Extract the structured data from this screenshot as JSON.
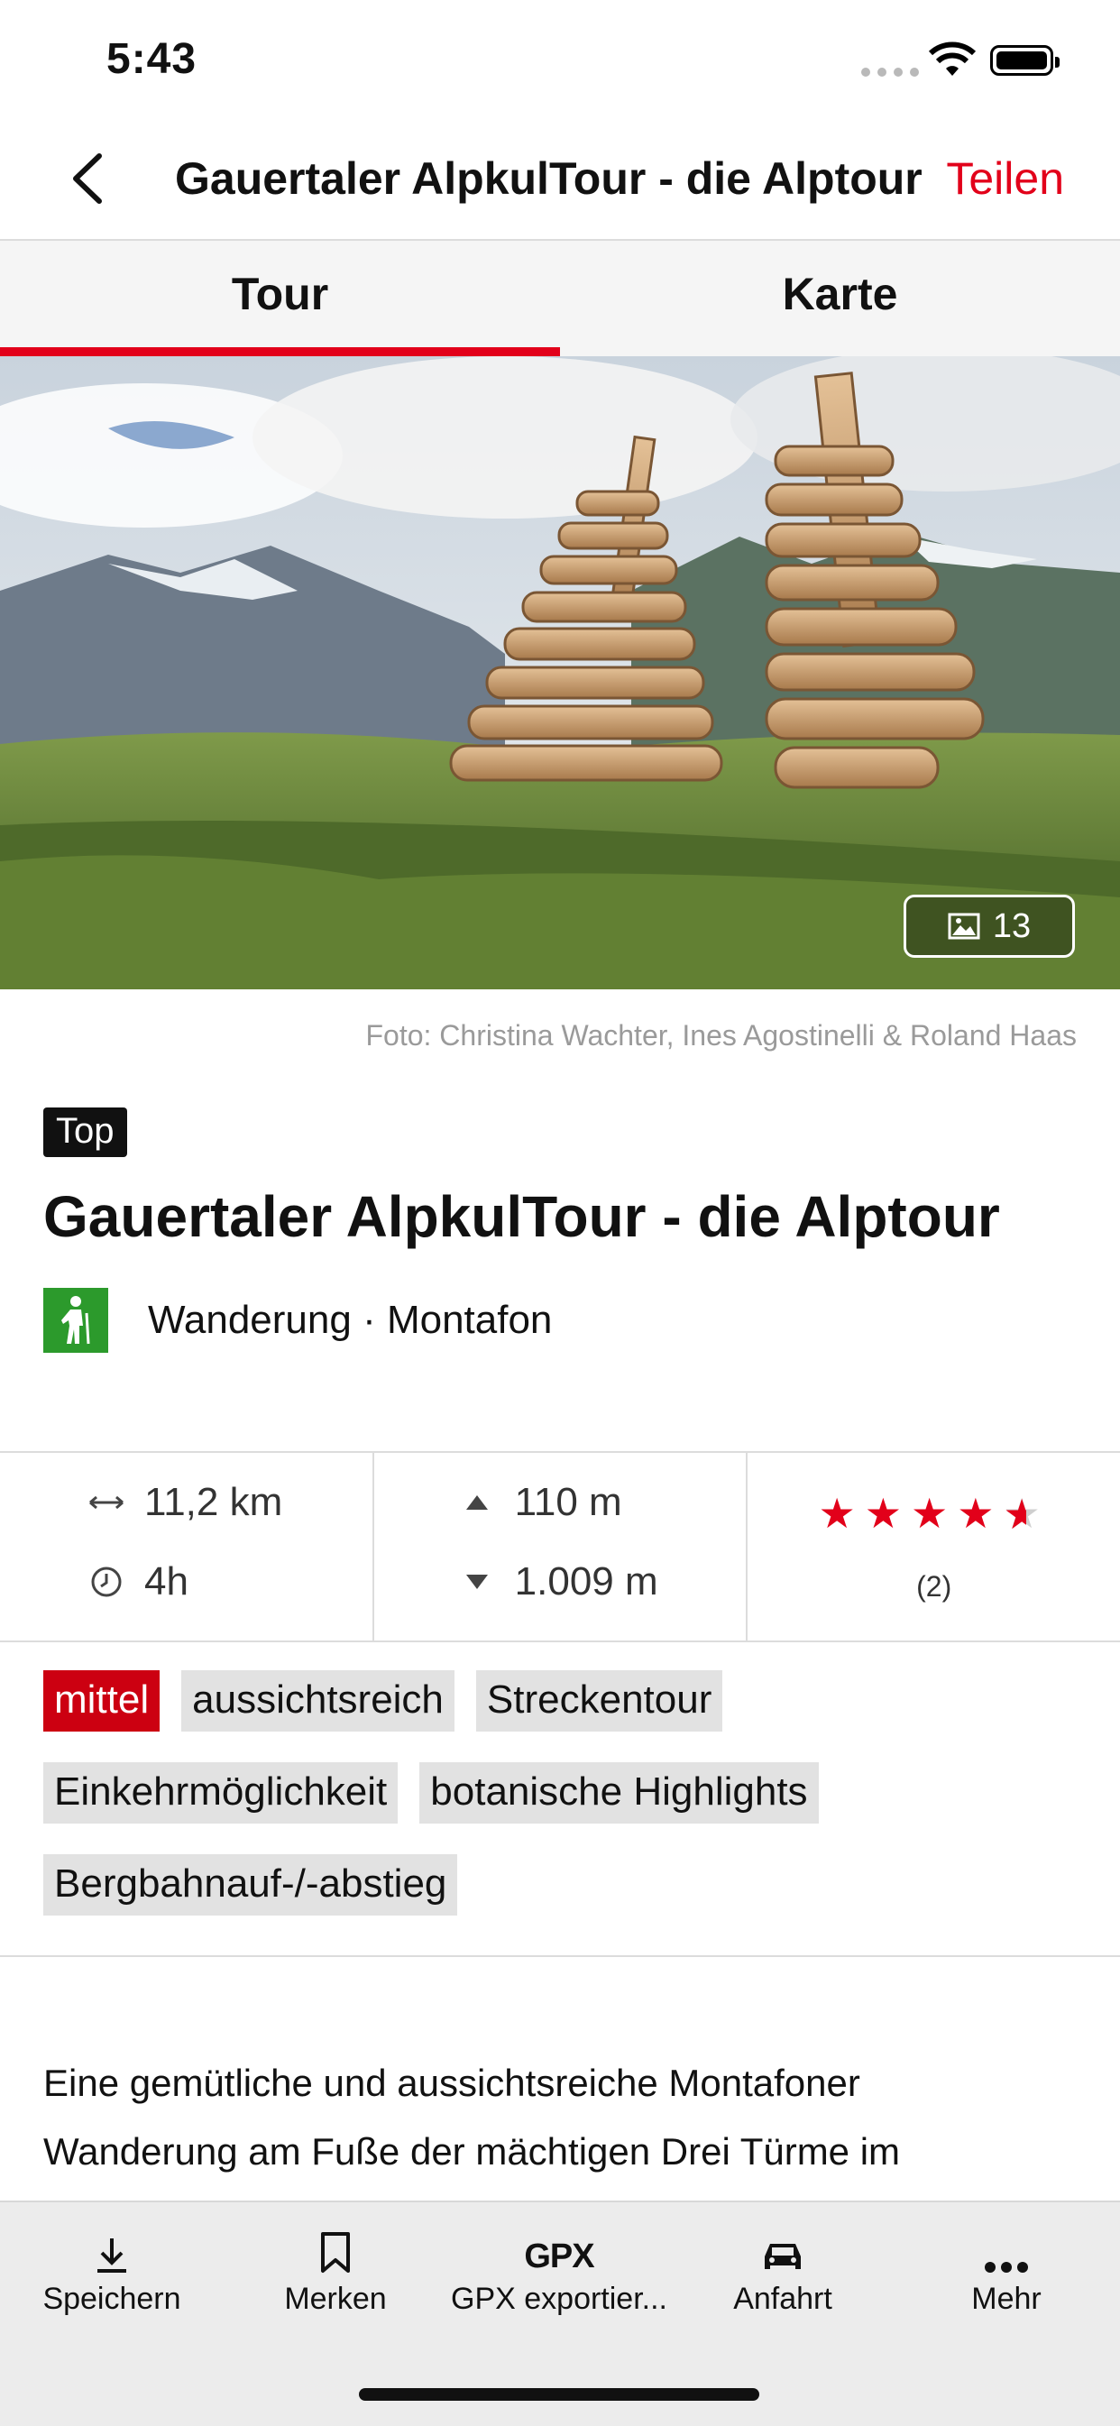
{
  "status_bar": {
    "time": "5:43"
  },
  "navbar": {
    "title": "Gauertaler AlpkulTour - die Alptour",
    "share_label": "Teilen"
  },
  "tabs": [
    {
      "label": "Tour",
      "active": true
    },
    {
      "label": "Karte",
      "active": false
    }
  ],
  "hero": {
    "photo_count": "13",
    "credit": "Foto: Christina Wachter, Ines Agostinelli & Roland Haas"
  },
  "header": {
    "badge": "Top",
    "title": "Gauertaler AlpkulTour - die Alptour",
    "category": "Wanderung · Montafon"
  },
  "stats": {
    "distance": "11,2 km",
    "duration": "4h",
    "ascent": "110 m",
    "descent": "1.009 m",
    "rating": 4.5,
    "rating_count": "(2)"
  },
  "tags": [
    [
      "mittel",
      "aussichtsreich",
      "Streckentour"
    ],
    [
      "Einkehrmöglichkeit",
      "botanische Highlights"
    ],
    [
      "Bergbahnauf-/-abstieg"
    ]
  ],
  "description": {
    "line1": "Eine gemütliche und aussichtsreiche Montafoner",
    "line2": "Wanderung am Fuße der mächtigen Drei Türme im"
  },
  "toolbar": {
    "save": "Speichern",
    "bookmark": "Merken",
    "gpx_icon": "GPX",
    "gpx": "GPX exportier...",
    "directions": "Anfahrt",
    "more": "Mehr"
  },
  "colors": {
    "accent": "#e2001a",
    "difficulty": "#cc0011",
    "category_green": "#2c9a2c"
  }
}
